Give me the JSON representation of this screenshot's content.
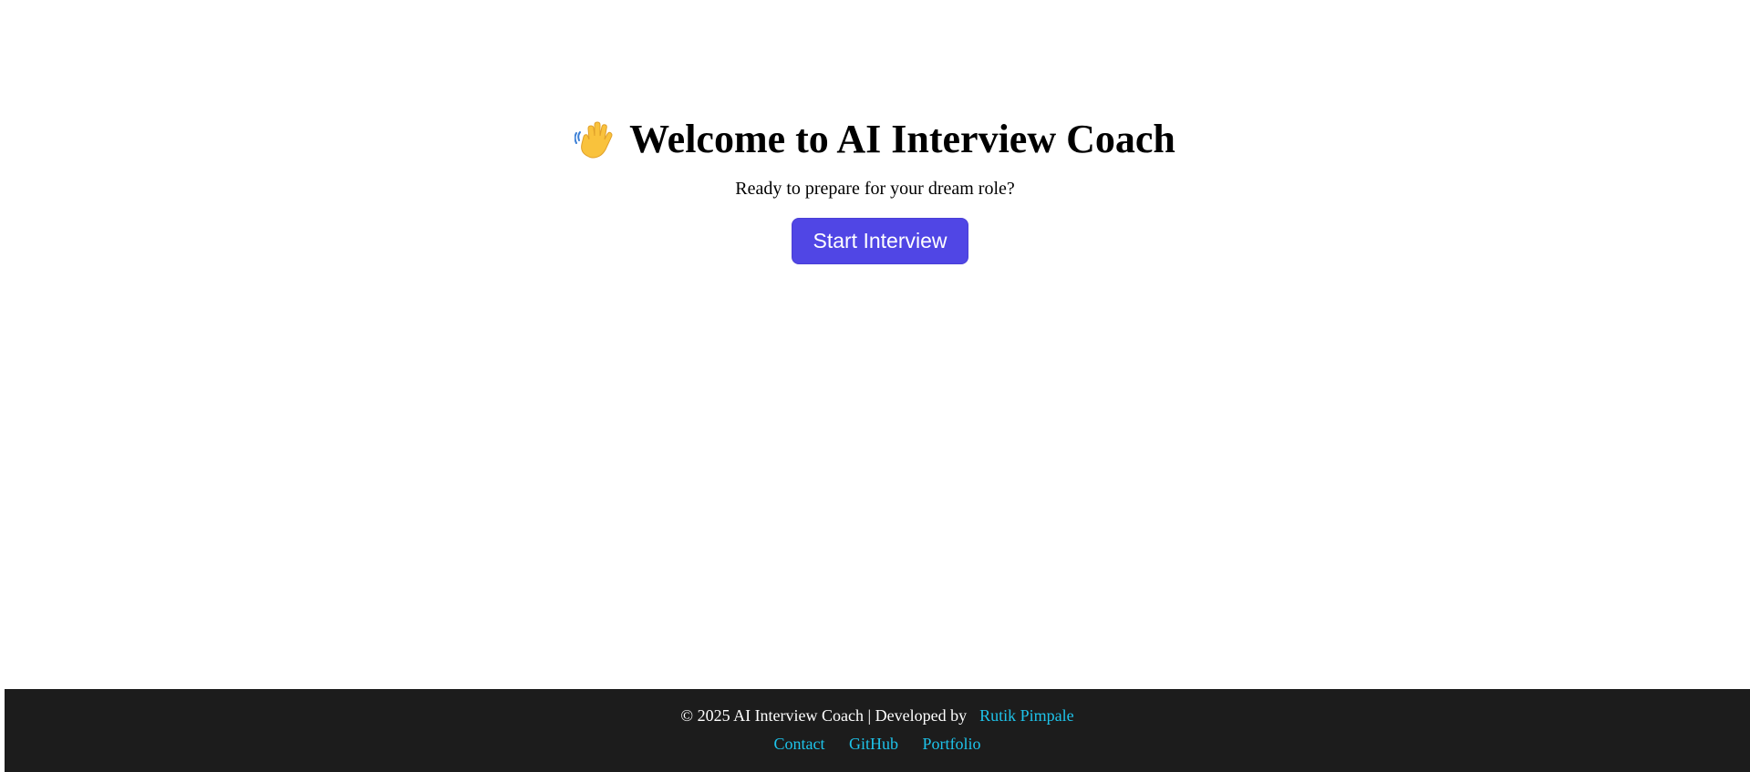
{
  "hero": {
    "title": "Welcome to AI Interview Coach",
    "icon": "waving-hand-icon",
    "subtitle": "Ready to prepare for your dream role?",
    "start_button_label": "Start Interview"
  },
  "footer": {
    "copyright_text": "© 2025 AI Interview Coach | Developed by",
    "author_link": "Rutik Pimpale",
    "links": [
      "Contact",
      "GitHub",
      "Portfolio"
    ]
  },
  "colors": {
    "accent": "#5046e5",
    "footer_bg": "#1c1c1c",
    "link": "#1ec3ea"
  }
}
